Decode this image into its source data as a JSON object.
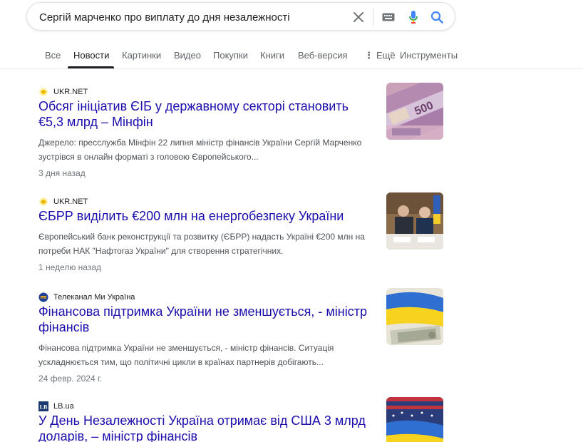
{
  "search": {
    "query": "Сергій марченко про виплату до дня незалежності"
  },
  "icons": {
    "clear": "close-icon",
    "keyboard": "keyboard-icon",
    "mic": "microphone-icon",
    "search": "search-icon"
  },
  "tabs": [
    {
      "label": "Все",
      "active": false
    },
    {
      "label": "Новости",
      "active": true
    },
    {
      "label": "Картинки",
      "active": false
    },
    {
      "label": "Видео",
      "active": false
    },
    {
      "label": "Покупки",
      "active": false
    },
    {
      "label": "Книги",
      "active": false
    },
    {
      "label": "Веб-версия",
      "active": false
    },
    {
      "label": "Ещё",
      "active": false
    },
    {
      "label": "Инструменты",
      "active": false
    }
  ],
  "results": [
    {
      "source": "UKR.NET",
      "title": "Обсяг ініціатив ЄІБ у державному секторі становить €5,3 млрд – Мінфін",
      "snippet": "Джерело: пресслужба Мінфін 22 липня міністр фінансів України Сергій Марченко зустрівся в онлайн форматі з головою Європейського...",
      "date": "3 дня назад",
      "thumb": "euro-banknotes-image"
    },
    {
      "source": "UKR.NET",
      "title": "ЄБРР виділить €200 млн на енергобезпеку України",
      "snippet": "Європейський банк реконструкції та розвитку (ЄБРР) надасть Україні €200 млн на потреби НАК \"Нафтогаз України\" для створення стратегічних.",
      "date": "1 неделю назад",
      "thumb": "signing-ceremony-image"
    },
    {
      "source": "Телеканал Ми Україна",
      "title": "Фінансова підтримка України не зменшується, - міністр фінансів",
      "snippet": "Фінансова підтримка України не зменшується, - міністр фінансів. Ситуація ускладнюється тим, що політичні цикли в країнах партнерів добігають...",
      "date": "24 февр. 2024 г.",
      "thumb": "ukraine-flag-dollars-image"
    },
    {
      "source": "LB.ua",
      "title": "У День Незалежності Україна отримає від США 3 млрд доларів, – міністр фінансів",
      "snippet": "",
      "date": "",
      "thumb": "us-ukraine-flags-image"
    }
  ]
}
